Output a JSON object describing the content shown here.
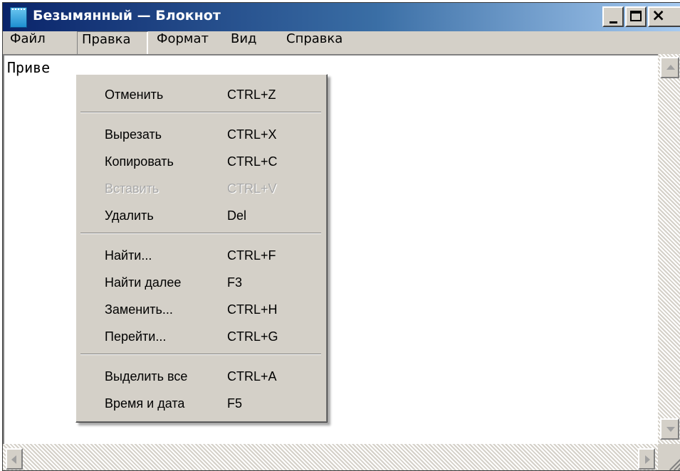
{
  "window": {
    "title": "Безымянный — Блокнот",
    "icon": "notepad-icon",
    "buttons": {
      "minimize": "minimize-icon",
      "maximize": "maximize-icon",
      "close_glyph": "×"
    }
  },
  "menubar": {
    "items": [
      {
        "label": "Файл"
      },
      {
        "label": "Правка",
        "active": true
      },
      {
        "label": "Формат"
      },
      {
        "label": "Вид"
      },
      {
        "label": "Справка"
      }
    ]
  },
  "editor": {
    "text": "Приве"
  },
  "dropdown": {
    "groups": [
      [
        {
          "label": "Отменить",
          "shortcut": "CTRL+Z",
          "enabled": true
        }
      ],
      [
        {
          "label": "Вырезать",
          "shortcut": "CTRL+X",
          "enabled": true
        },
        {
          "label": "Копировать",
          "shortcut": "CTRL+C",
          "enabled": true
        },
        {
          "label": "Вставить",
          "shortcut": "CTRL+V",
          "enabled": false
        },
        {
          "label": "Удалить",
          "shortcut": "Del",
          "enabled": true
        }
      ],
      [
        {
          "label": "Найти...",
          "shortcut": "CTRL+F",
          "enabled": true
        },
        {
          "label": "Найти далее",
          "shortcut": "F3",
          "enabled": true
        },
        {
          "label": "Заменить...",
          "shortcut": "CTRL+H",
          "enabled": true
        },
        {
          "label": "Перейти...",
          "shortcut": "CTRL+G",
          "enabled": true
        }
      ],
      [
        {
          "label": "Выделить все",
          "shortcut": "CTRL+A",
          "enabled": true
        },
        {
          "label": "Время и дата",
          "shortcut": "F5",
          "enabled": true
        }
      ]
    ]
  },
  "colors": {
    "titlebar_start": "#0a246a",
    "titlebar_end": "#a6caf0",
    "menu_bg": "#d4d0c8",
    "disabled_text": "#a8a8a8"
  }
}
